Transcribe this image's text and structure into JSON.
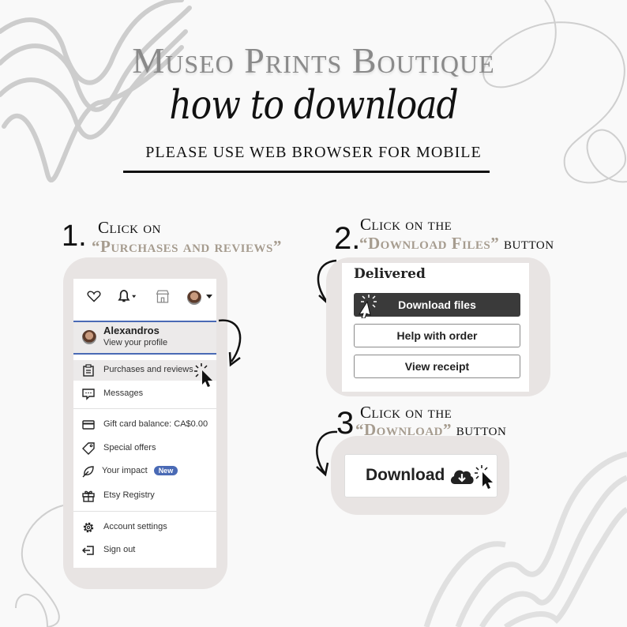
{
  "header": {
    "brand": "Museo Prints Boutique",
    "script_title": "how to download",
    "subtitle": "PLEASE USE WEB BROWSER FOR MOBILE"
  },
  "steps": [
    {
      "number": "1.",
      "line1": "Click on",
      "highlight": "“Purchases and reviews”",
      "suffix": ""
    },
    {
      "number": "2.",
      "line1": "Click on the",
      "highlight": "“Download Files”",
      "suffix": " button"
    },
    {
      "number": "3",
      "line1": "Click on the",
      "highlight": "“Download”",
      "suffix": " button"
    }
  ],
  "account_menu": {
    "top_icons": [
      "heart-icon",
      "bell-icon",
      "shop-icon",
      "avatar"
    ],
    "profile": {
      "name": "Alexandros",
      "link": "View your profile"
    },
    "items": [
      {
        "icon": "clipboard-icon",
        "label": "Purchases and reviews",
        "active": true
      },
      {
        "icon": "message-icon",
        "label": "Messages"
      },
      {
        "icon": "card-icon",
        "label": "Gift card balance: CA$0.00"
      },
      {
        "icon": "tag-icon",
        "label": "Special offers"
      },
      {
        "icon": "leaf-icon",
        "label": "Your impact",
        "badge": "New"
      },
      {
        "icon": "gift-icon",
        "label": "Etsy Registry"
      },
      {
        "icon": "gear-icon",
        "label": "Account settings"
      },
      {
        "icon": "sign-out-icon",
        "label": "Sign out"
      }
    ]
  },
  "order_panel": {
    "status": "Delivered",
    "buttons": [
      "Download files",
      "Help with order",
      "View receipt"
    ]
  },
  "download_panel": {
    "label": "Download"
  },
  "colors": {
    "accent": "#a69c8f",
    "frame": "#e8e4e3",
    "badge_blue": "#4a6ab5",
    "dark_button": "#3a3a3a"
  }
}
